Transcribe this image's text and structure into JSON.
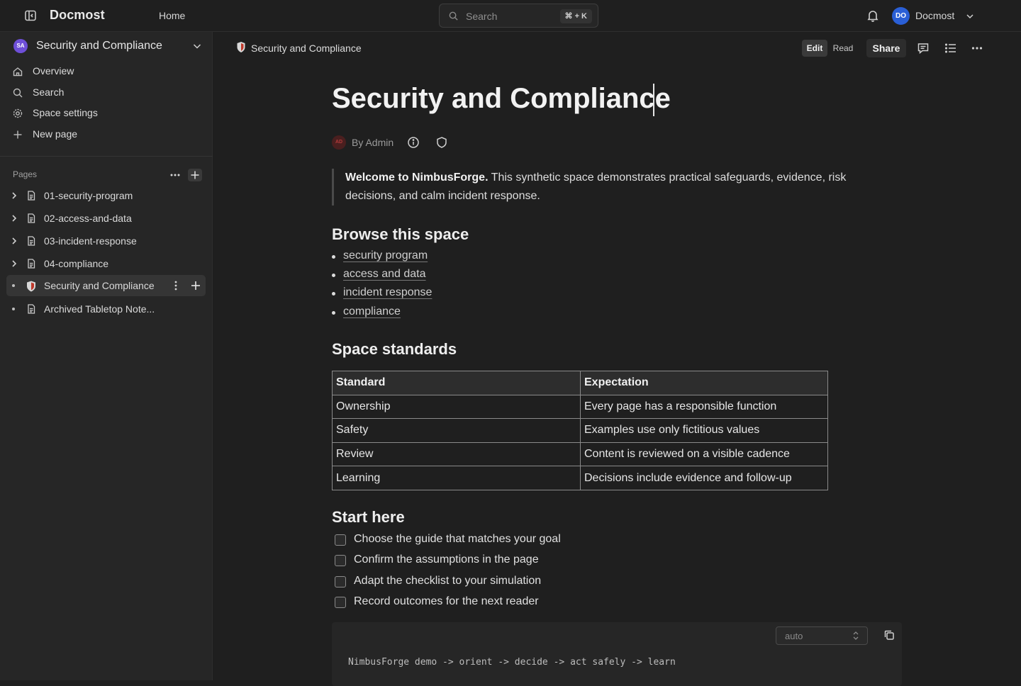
{
  "app": {
    "brand": "Docmost",
    "home_label": "Home"
  },
  "search": {
    "placeholder": "Search",
    "shortcut": "⌘ + K"
  },
  "user": {
    "initials": "DO",
    "name": "Docmost"
  },
  "space": {
    "initials": "SA",
    "name": "Security and Compliance",
    "nav": [
      {
        "label": "Overview",
        "icon": "home-icon"
      },
      {
        "label": "Search",
        "icon": "search-icon"
      },
      {
        "label": "Space settings",
        "icon": "gear-icon"
      },
      {
        "label": "New page",
        "icon": "plus-icon"
      }
    ]
  },
  "pages": {
    "label": "Pages",
    "items": [
      {
        "label": "01-security-program",
        "expandable": true
      },
      {
        "label": "02-access-and-data",
        "expandable": true
      },
      {
        "label": "03-incident-response",
        "expandable": true
      },
      {
        "label": "04-compliance",
        "expandable": true
      },
      {
        "label": "Security and Compliance",
        "expandable": false,
        "active": true,
        "icon": "shield-emoji-icon"
      },
      {
        "label": "Archived Tabletop Note...",
        "expandable": false
      }
    ]
  },
  "header": {
    "breadcrumb": "Security and Compliance",
    "mode_edit": "Edit",
    "mode_read": "Read",
    "share_label": "Share"
  },
  "document": {
    "title": "Security and Compliance",
    "author_initials": "AD",
    "byline": "By Admin",
    "quote_bold": "Welcome to NimbusForge.",
    "quote_rest": " This synthetic space demonstrates practical safeguards, evidence, risk decisions, and calm incident response.",
    "browse_heading": "Browse this space",
    "browse_links": [
      "security program",
      "access and data",
      "incident response",
      "compliance"
    ],
    "standards_heading": "Space standards",
    "standards_table": {
      "headers": [
        "Standard",
        "Expectation"
      ],
      "rows": [
        [
          "Ownership",
          "Every page has a responsible function"
        ],
        [
          "Safety",
          "Examples use only fictitious values"
        ],
        [
          "Review",
          "Content is reviewed on a visible cadence"
        ],
        [
          "Learning",
          "Decisions include evidence and follow-up"
        ]
      ]
    },
    "start_heading": "Start here",
    "tasks": [
      "Choose the guide that matches your goal",
      "Confirm the assumptions in the page",
      "Adapt the checklist to your simulation",
      "Record outcomes for the next reader"
    ],
    "code_language": "auto",
    "code": "NimbusForge demo -> orient -> decide -> act safely -> learn"
  }
}
